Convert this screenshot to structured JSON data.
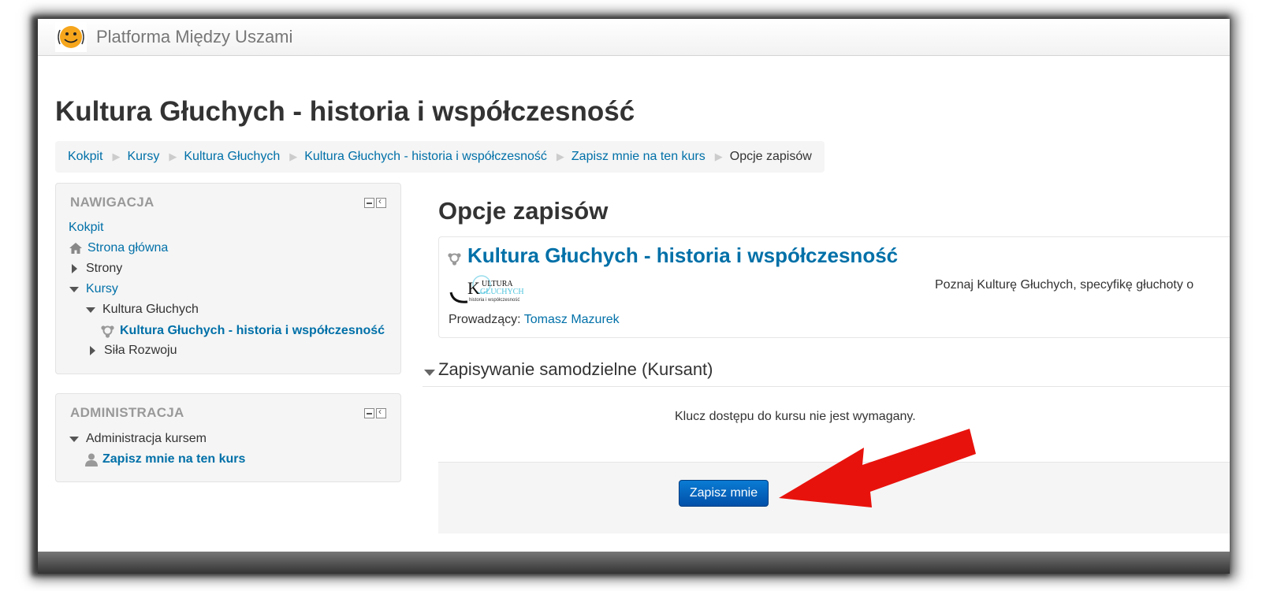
{
  "navbar": {
    "site_name": "Platforma Między Uszami"
  },
  "page": {
    "title": "Kultura Głuchych - historia i współczesność"
  },
  "breadcrumb": [
    "Kokpit",
    "Kursy",
    "Kultura Głuchych",
    "Kultura Głuchych - historia i współczesność",
    "Zapisz mnie na ten kurs",
    "Opcje zapisów"
  ],
  "navigation": {
    "title": "NAWIGACJA",
    "items": [
      {
        "label": "Kokpit"
      },
      {
        "label": "Strona główna",
        "icon": "home-icon"
      },
      {
        "label": "Strony"
      },
      {
        "label": "Kursy"
      },
      {
        "label": "Kultura Głuchych"
      },
      {
        "label": "Kultura Głuchych - historia i współczesność",
        "icon": "course-icon"
      },
      {
        "label": "Siła Rozwoju"
      }
    ]
  },
  "administration": {
    "title": "ADMINISTRACJA",
    "items": [
      {
        "label": "Administracja kursem"
      },
      {
        "label": "Zapisz mnie na ten kurs",
        "icon": "user-icon"
      }
    ]
  },
  "main": {
    "heading": "Opcje zapisów",
    "course": {
      "title": "Kultura Głuchych - historia i współczesność",
      "image_text_k": "K",
      "image_text_kultura": "ULTURA",
      "image_text_gluchych": "GŁUCHYCH",
      "image_text_sub": "historia i współczesność",
      "summary": "Poznaj Kulturę Głuchych, specyfikę głuchoty o",
      "teacher_label": "Prowadzący:",
      "teacher_name": "Tomasz Mazurek"
    },
    "section": {
      "title": "Zapisywanie samodzielne (Kursant)",
      "message": "Klucz dostępu do kursu nie jest wymagany.",
      "button_label": "Zapisz mnie"
    }
  },
  "colors": {
    "link": "#0070a8",
    "button": "#0150a8",
    "arrow": "#e8120c"
  }
}
